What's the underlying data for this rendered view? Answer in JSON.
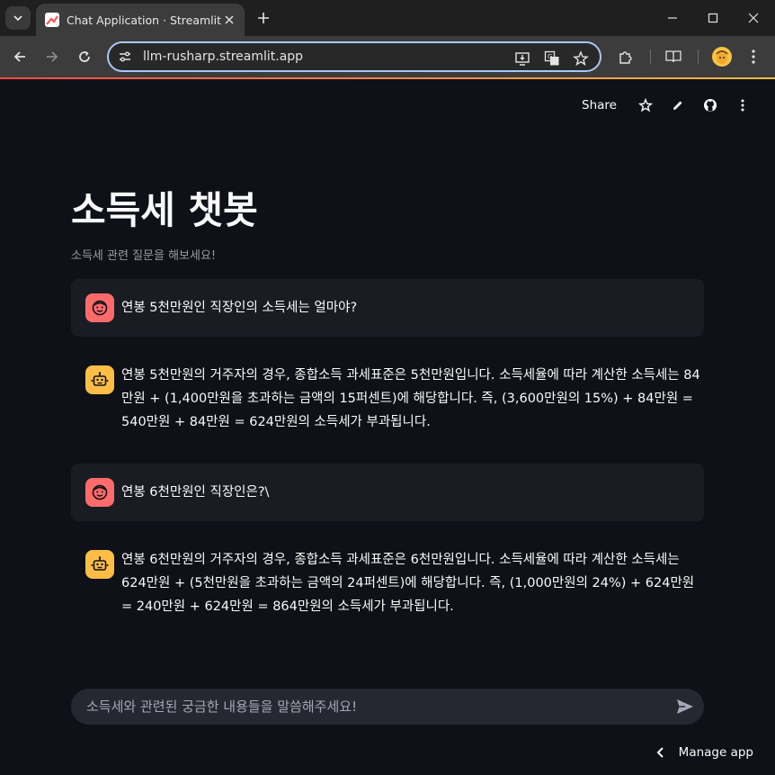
{
  "browser": {
    "tab_title": "Chat Application · Streamlit",
    "url": "llm-rusharp.streamlit.app"
  },
  "header": {
    "share_label": "Share"
  },
  "page": {
    "title": "소득세 챗봇",
    "caption": "소득세 관련 질문을 해보세요!"
  },
  "messages": [
    {
      "role": "user",
      "text": "연봉 5천만원인 직장인의 소득세는 얼마야?"
    },
    {
      "role": "assistant",
      "text": "연봉 5천만원의 거주자의 경우, 종합소득 과세표준은 5천만원입니다. 소득세율에 따라 계산한 소득세는 84만원 + (1,400만원을 초과하는 금액의 15퍼센트)에 해당합니다. 즉, (3,600만원의 15%) + 84만원 = 540만원 + 84만원 = 624만원의 소득세가 부과됩니다."
    },
    {
      "role": "user",
      "text": "연봉 6천만원인 직장인은?\\"
    },
    {
      "role": "assistant",
      "text": "연봉 6천만원의 거주자의 경우, 종합소득 과세표준은 6천만원입니다. 소득세율에 따라 계산한 소득세는 624만원 + (5천만원을 초과하는 금액의 24퍼센트)에 해당합니다. 즉, (1,000만원의 24%) + 624만원 = 240만원 + 624만원 = 864만원의 소득세가 부과됩니다."
    }
  ],
  "chat_input": {
    "placeholder": "소득세와 관련된 궁금한 내용들을 말씀해주세요!"
  },
  "footer": {
    "manage_label": "Manage app"
  },
  "colors": {
    "background": "#0e1117",
    "user_avatar": "#ff6b6b",
    "assistant_avatar": "#ffbd45",
    "user_bubble": "#1a1c24"
  }
}
